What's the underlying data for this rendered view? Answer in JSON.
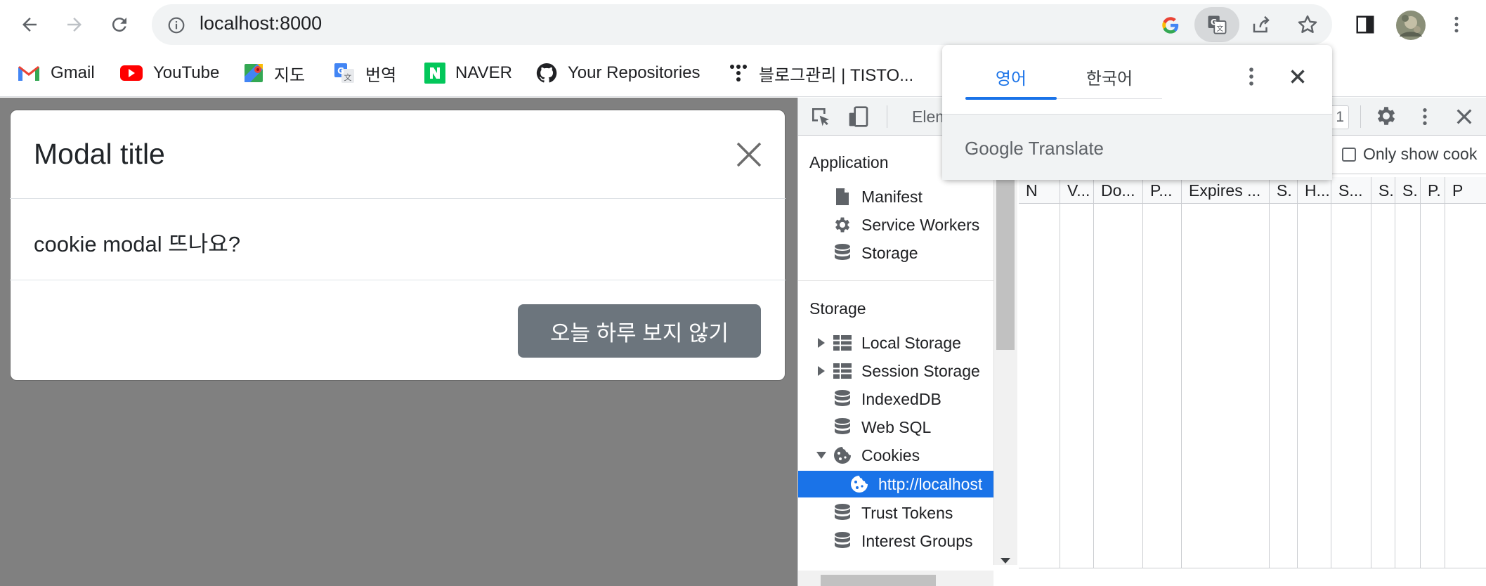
{
  "browser": {
    "url": "localhost:8000",
    "bookmarks": [
      {
        "label": "Gmail",
        "icon": "gmail-icon"
      },
      {
        "label": "YouTube",
        "icon": "youtube-icon"
      },
      {
        "label": "지도",
        "icon": "maps-icon"
      },
      {
        "label": "번역",
        "icon": "translate-icon"
      },
      {
        "label": "NAVER",
        "icon": "naver-icon"
      },
      {
        "label": "Your Repositories",
        "icon": "github-icon"
      },
      {
        "label": "블로그관리 | TISTO...",
        "icon": "tistory-icon"
      }
    ]
  },
  "modal": {
    "title": "Modal title",
    "body": "cookie modal 뜨나요?",
    "button_label": "오늘 하루 보지 않기"
  },
  "devtools": {
    "elements_tab": "Elem",
    "sidebar": {
      "application_header": "Application",
      "application_items": [
        "Manifest",
        "Service Workers",
        "Storage"
      ],
      "storage_header": "Storage",
      "storage_items": [
        "Local Storage",
        "Session Storage",
        "IndexedDB",
        "Web SQL",
        "Cookies"
      ],
      "cookie_child": "http://localhost",
      "other_items": [
        "Trust Tokens",
        "Interest Groups"
      ]
    },
    "filter": {
      "only_show_label": "Only show cook",
      "partial_count": "1"
    },
    "columns": [
      "N",
      "V...",
      "Do...",
      "P...",
      "Expires ...",
      "S.",
      "H...",
      "S...",
      "S.",
      "S.",
      "P.",
      "P"
    ]
  },
  "translate_popup": {
    "tabs": [
      "영어",
      "한국어"
    ],
    "brand": "Google Translate"
  },
  "colors": {
    "accent": "#1a73e8",
    "modal_button": "#6c757d",
    "overlay": "#808080"
  }
}
